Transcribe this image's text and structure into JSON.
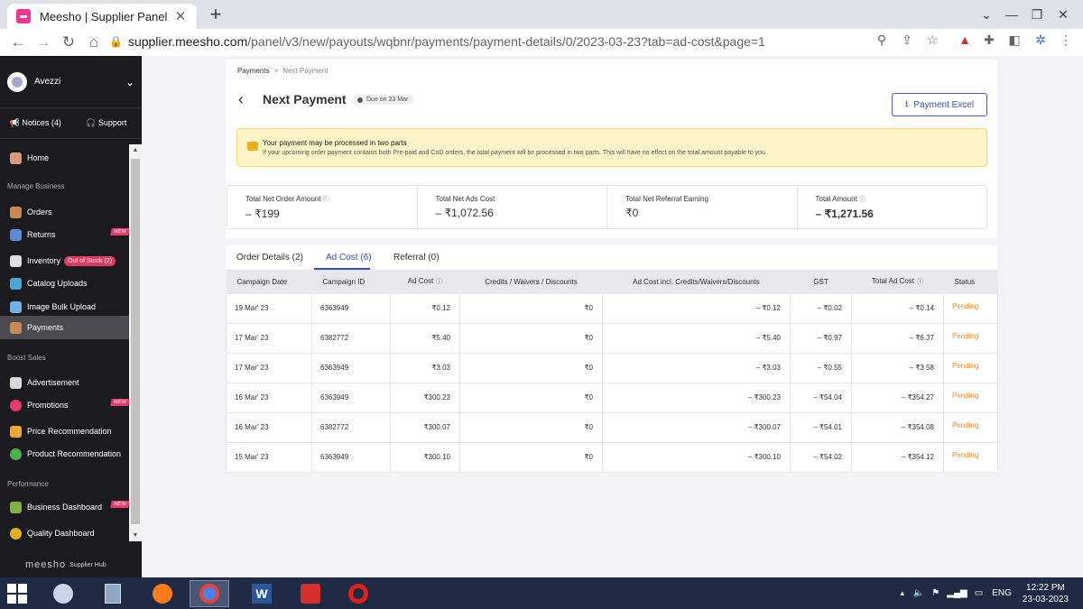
{
  "browser": {
    "tab_title": "Meesho | Supplier Panel",
    "url_host": "supplier.meesho.com",
    "url_path": "/panel/v3/new/payouts/wqbnr/payments/payment-details/0/2023-03-23?tab=ad-cost&page=1"
  },
  "sidebar": {
    "account_name": "Avezzi",
    "notices_label": "Notices (4)",
    "support_label": "Support",
    "items": {
      "home": "Home",
      "manage_business": "Manage Business",
      "orders": "Orders",
      "returns": "Returns",
      "inventory": "Inventory",
      "inventory_badge": "Out of Stock (2)",
      "catalog_uploads": "Catalog Uploads",
      "image_bulk_upload": "Image Bulk Upload",
      "payments": "Payments",
      "boost_sales": "Boost Sales",
      "advertisement": "Advertisement",
      "promotions": "Promotions",
      "price_recommendation": "Price Recommendation",
      "product_recommendation": "Product Recommendation",
      "performance": "Performance",
      "business_dashboard": "Business Dashboard",
      "quality_dashboard": "Quality Dashboard"
    },
    "new_badge": "NEW",
    "footer_brand": "meesho",
    "footer_sub": "Supplier Hub"
  },
  "page": {
    "breadcrumb_root": "Payments",
    "breadcrumb_current": "Next Payment",
    "title": "Next Payment",
    "due_label": "Due on 23 Mar",
    "excel_button": "Payment Excel",
    "notice_title": "Your payment may be processed in two parts",
    "notice_desc": "If your upcoming order payment contains both Pre-paid and CoD orders, the total payment will be processed in two parts. This will have no effect on the total amount payable to you.",
    "summary": [
      {
        "label": "Total Net Order Amount",
        "value": "– ₹199"
      },
      {
        "label": "Total Net Ads Cost",
        "value": "– ₹1,072.56"
      },
      {
        "label": "Total Net Referral Earning",
        "value": "₹0"
      },
      {
        "label": "Total Amount",
        "value": "– ₹1,271.56"
      }
    ],
    "tabs": [
      "Order Details (2)",
      "Ad Cost (6)",
      "Referral (0)"
    ]
  },
  "table": {
    "headers": [
      "Campaign Date",
      "Campaign ID",
      "Ad Cost",
      "Credits / Waivers / Discounts",
      "Ad Cost incl. Credits/Waivers/Discounts",
      "GST",
      "Total Ad Cost",
      "Status"
    ],
    "rows": [
      {
        "date": "19 Mar' 23",
        "id": "6363949",
        "ad_cost": "₹0.12",
        "credits": "₹0",
        "incl": "– ₹0.12",
        "gst": "– ₹0.02",
        "total": "– ₹0.14",
        "status": "Pending"
      },
      {
        "date": "17 Mar' 23",
        "id": "6382772",
        "ad_cost": "₹5.40",
        "credits": "₹0",
        "incl": "– ₹5.40",
        "gst": "– ₹0.97",
        "total": "– ₹6.37",
        "status": "Pending"
      },
      {
        "date": "17 Mar' 23",
        "id": "6363949",
        "ad_cost": "₹3.03",
        "credits": "₹0",
        "incl": "– ₹3.03",
        "gst": "– ₹0.55",
        "total": "– ₹3.58",
        "status": "Pending"
      },
      {
        "date": "16 Mar' 23",
        "id": "6363949",
        "ad_cost": "₹300.23",
        "credits": "₹0",
        "incl": "– ₹300.23",
        "gst": "– ₹54.04",
        "total": "– ₹354.27",
        "status": "Pending"
      },
      {
        "date": "16 Mar' 23",
        "id": "6382772",
        "ad_cost": "₹300.07",
        "credits": "₹0",
        "incl": "– ₹300.07",
        "gst": "– ₹54.01",
        "total": "– ₹354.08",
        "status": "Pending"
      },
      {
        "date": "15 Mar' 23",
        "id": "6363949",
        "ad_cost": "₹300.10",
        "credits": "₹0",
        "incl": "– ₹300.10",
        "gst": "– ₹54.02",
        "total": "– ₹354.12",
        "status": "Pending"
      }
    ]
  },
  "taskbar": {
    "language": "ENG",
    "time": "12:22 PM",
    "date": "23-03-2023"
  },
  "colors": {
    "accent": "#3b4bb8",
    "pending": "#f08a24",
    "brand": "#f43397",
    "sidebar_bg": "#1b1b1f"
  }
}
